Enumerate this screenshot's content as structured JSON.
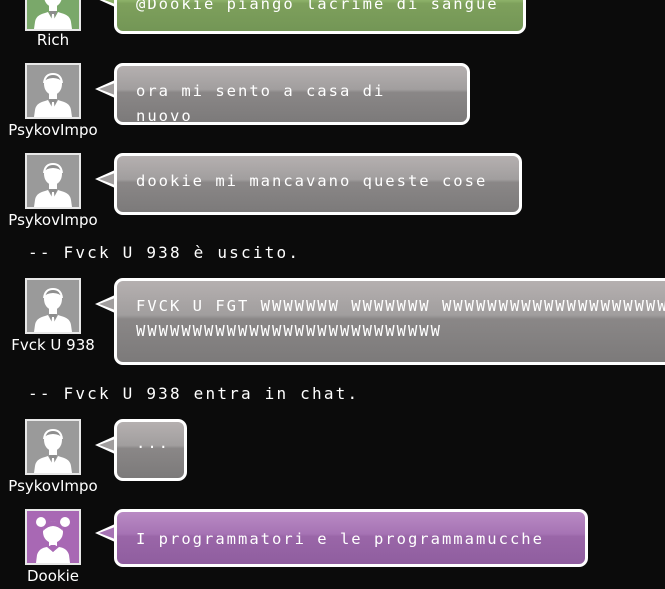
{
  "colors": {
    "background": "#0b0b0b",
    "bubble_gray": "#8a8787",
    "bubble_green": "#8cb068",
    "bubble_purple": "#a673b4",
    "bubble_border": "#ffffff"
  },
  "messages": [
    {
      "user": "Rich",
      "text": "@Dookie piango lacrime di sangue",
      "avatar_icon": "male-user-icon"
    },
    {
      "user": "PsykovImpo",
      "text": "ora mi sento a casa di nuovo",
      "avatar_icon": "male-user-icon"
    },
    {
      "user": "PsykovImpo",
      "text": "dookie mi mancavano queste cose",
      "avatar_icon": "male-user-icon"
    },
    {
      "user": "Fvck U 938",
      "text": "FVCK U FGT WWWWWWW WWWWWWW WWWWWWWWWWWWWWWWWWWWWWWWWWWWWWWWWWWWWWWWWWWWWWW",
      "avatar_icon": "male-user-icon"
    },
    {
      "user": "PsykovImpo",
      "text": "...",
      "avatar_icon": "male-user-icon"
    },
    {
      "user": "Dookie",
      "text": "I programmatori e le programmamucche",
      "avatar_icon": "female-user-icon"
    }
  ],
  "system": [
    {
      "text": "-- Fvck U 938 è uscito."
    },
    {
      "text": "-- Fvck U 938 entra in chat."
    }
  ]
}
